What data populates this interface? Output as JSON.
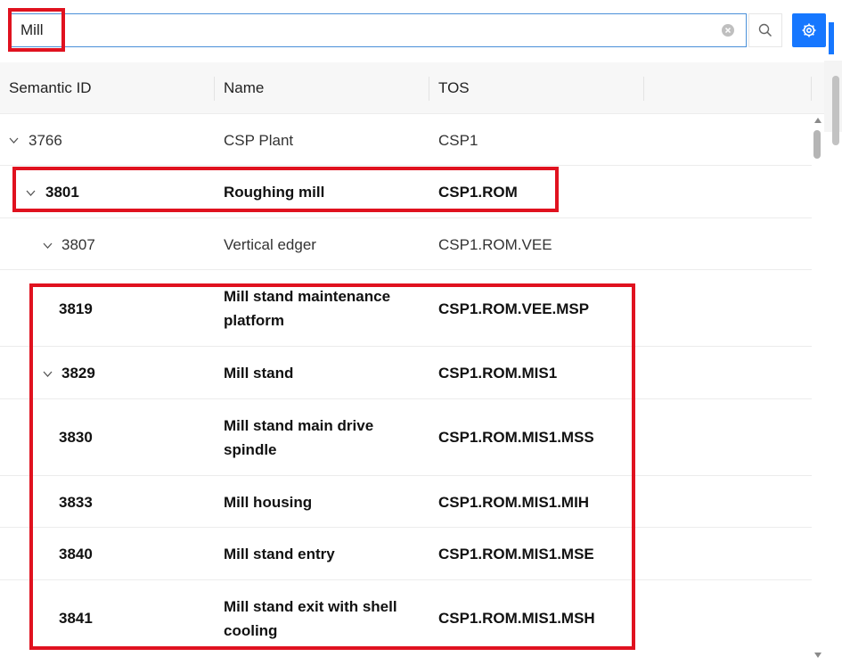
{
  "search": {
    "value": "Mill",
    "clear_icon": "clear-circle-icon",
    "search_icon": "search-icon",
    "settings_icon": "gear-icon"
  },
  "table": {
    "headers": [
      "Semantic ID",
      "Name",
      "TOS"
    ],
    "rows": [
      {
        "id": "3766",
        "name": "CSP Plant",
        "tos": "CSP1",
        "expanded": true,
        "bold": false
      },
      {
        "id": "3801",
        "name": "Roughing mill",
        "tos": "CSP1.ROM",
        "expanded": true,
        "bold": true
      },
      {
        "id": "3807",
        "name": "Vertical edger",
        "tos": "CSP1.ROM.VEE",
        "expanded": true,
        "bold": false
      },
      {
        "id": "3819",
        "name_line1": "Mill stand maintenance",
        "name_line2": "platform",
        "tos": "CSP1.ROM.VEE.MSP",
        "bold": true
      },
      {
        "id": "3829",
        "name": "Mill stand",
        "tos": "CSP1.ROM.MIS1",
        "expanded": true,
        "bold": true
      },
      {
        "id": "3830",
        "name_line1": "Mill stand main drive",
        "name_line2": "spindle",
        "tos": "CSP1.ROM.MIS1.MSS",
        "bold": true
      },
      {
        "id": "3833",
        "name": "Mill housing",
        "tos": "CSP1.ROM.MIS1.MIH",
        "bold": true
      },
      {
        "id": "3840",
        "name": "Mill stand entry",
        "tos": "CSP1.ROM.MIS1.MSE",
        "bold": true
      },
      {
        "id": "3841",
        "name_line1": "Mill stand exit with shell",
        "name_line2": "cooling",
        "tos": "CSP1.ROM.MIS1.MSH",
        "bold": true
      }
    ]
  },
  "colors": {
    "accent": "#1677ff",
    "highlight": "#e0121f",
    "input_border": "#4a90d9"
  }
}
